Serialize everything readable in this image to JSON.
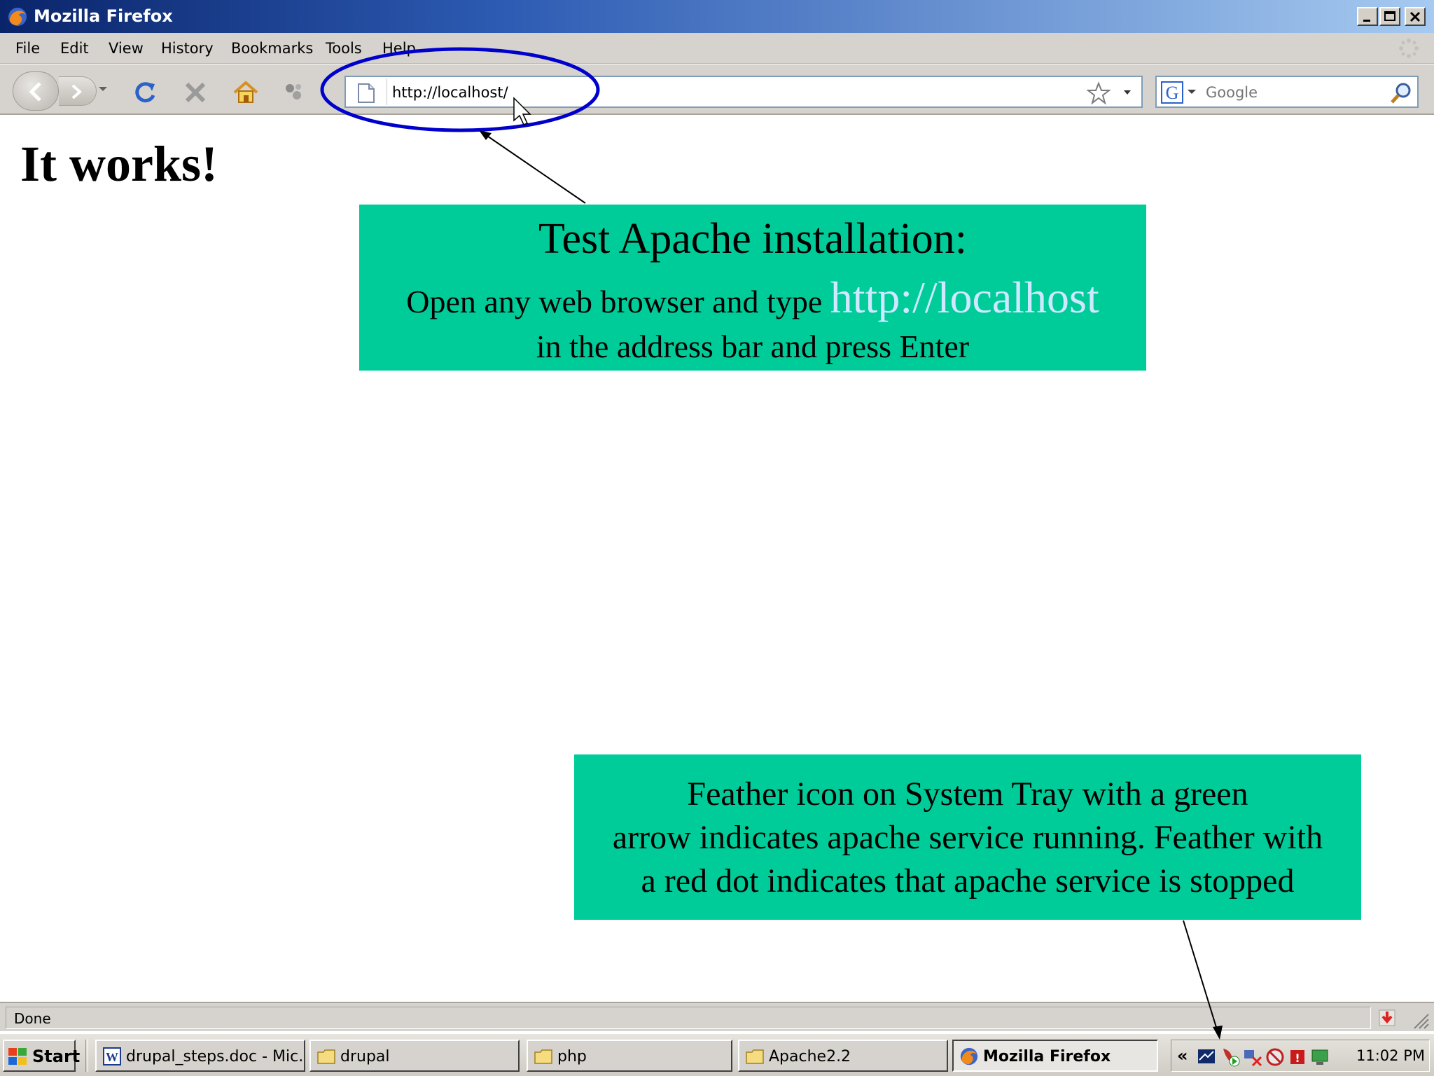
{
  "window": {
    "title": "Mozilla Firefox"
  },
  "menu": [
    "File",
    "Edit",
    "View",
    "History",
    "Bookmarks",
    "Tools",
    "Help"
  ],
  "address_bar": {
    "url": "http://localhost/"
  },
  "search_bar": {
    "engine": "Google",
    "placeholder": "Google"
  },
  "content": {
    "heading": "It works!"
  },
  "callout_top": {
    "title": "Test Apache installation:",
    "line1_prefix": "Open any web browser and type",
    "line1_link": "http://localhost",
    "line2": "in the address bar and press Enter"
  },
  "callout_bottom": {
    "line1": "Feather icon on System Tray with a green",
    "line2": "arrow indicates apache service running.  Feather with",
    "line3": "a red dot indicates that apache service is stopped"
  },
  "status_bar": {
    "text": "Done"
  },
  "taskbar": {
    "start_label": "Start",
    "tasks": [
      {
        "label": "drupal_steps.doc - Mic...",
        "icon": "word-doc-icon"
      },
      {
        "label": "drupal",
        "icon": "folder-icon"
      },
      {
        "label": "php",
        "icon": "folder-icon"
      },
      {
        "label": "Apache2.2",
        "icon": "folder-icon"
      },
      {
        "label": "Mozilla Firefox",
        "icon": "firefox-icon",
        "active": true
      }
    ],
    "tray_expand": "«",
    "clock": "11:02 PM"
  },
  "colors": {
    "callout_bg": "#00cc99",
    "highlight_ellipse": "#0000cc",
    "link_text": "#cfe8ff"
  }
}
